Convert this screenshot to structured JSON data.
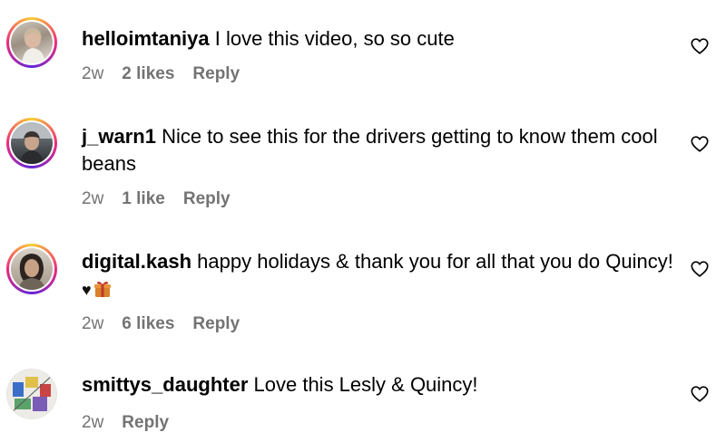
{
  "comments": [
    {
      "username": "helloimtaniya",
      "text": "I love this video, so so cute",
      "time": "2w",
      "likes": "2 likes",
      "reply": "Reply"
    },
    {
      "username": "j_warn1",
      "text": "Nice to see this for the drivers getting to know them cool beans",
      "time": "2w",
      "likes": "1 like",
      "reply": "Reply"
    },
    {
      "username": "digital.kash",
      "text": "happy holidays & thank you for all that you do Quincy!",
      "time": "2w",
      "likes": "6 likes",
      "reply": "Reply"
    },
    {
      "username": "smittys_daughter",
      "text": "Love this Lesly & Quincy!",
      "time": "2w",
      "reply": "Reply"
    }
  ],
  "emoji": {
    "black_heart": "♥"
  },
  "icons": {
    "like": "heart-outline-icon",
    "gift": "gift-icon"
  },
  "colors": {
    "meta_text": "#737373",
    "story_ring": "#ee2a7b",
    "text": "#000000"
  }
}
